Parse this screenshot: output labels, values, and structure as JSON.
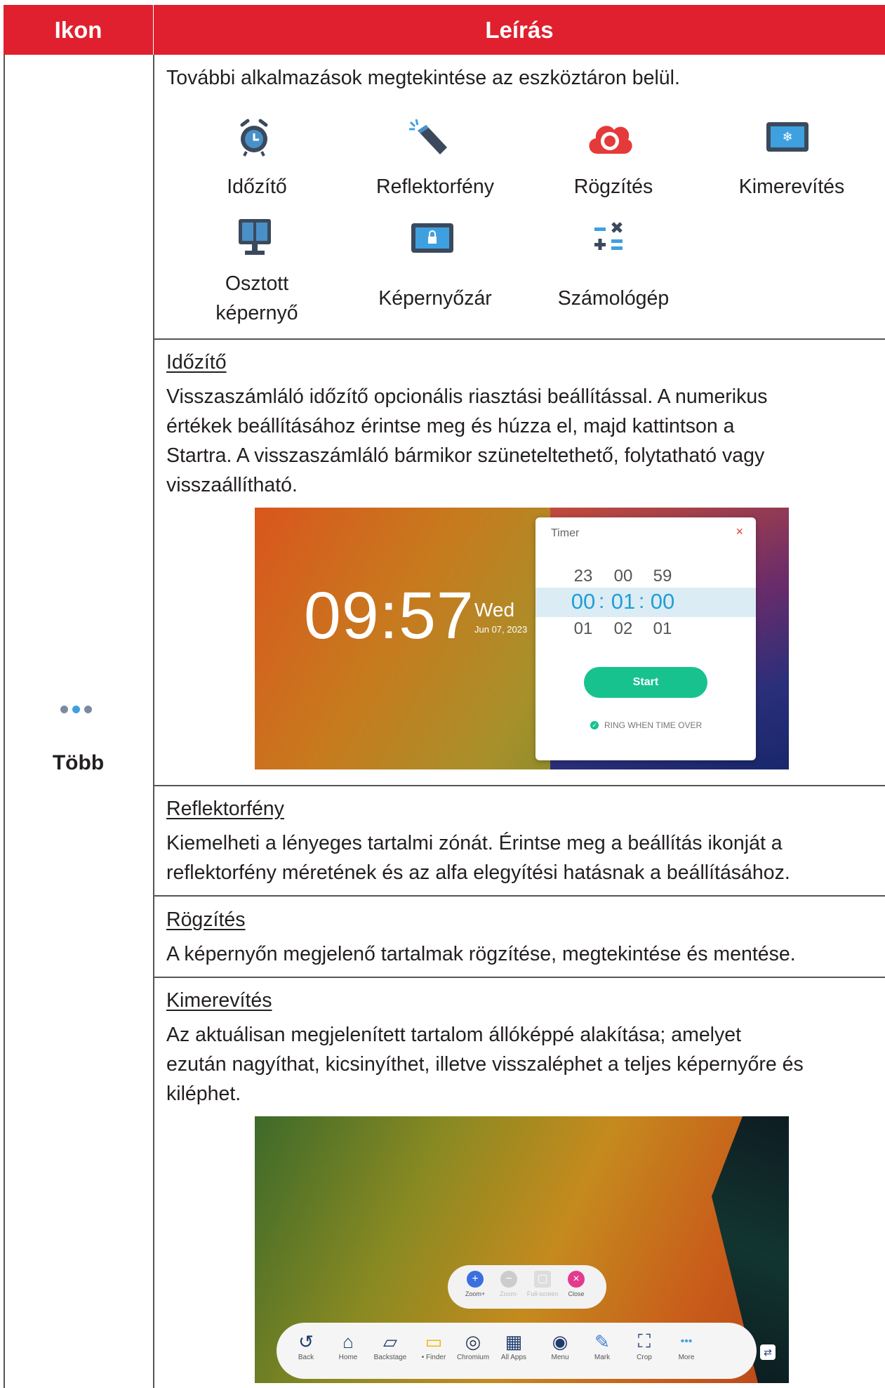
{
  "header": {
    "col1": "Ikon",
    "col2": "Leírás"
  },
  "icon_cell": {
    "label": "Több"
  },
  "intro": "További alkalmazások megtekintése az eszköztáron belül.",
  "apps": [
    {
      "icon": "alarm-clock-icon",
      "label": "Időzítő"
    },
    {
      "icon": "flashlight-icon",
      "label": "Reflektorfény"
    },
    {
      "icon": "record-cloud-icon",
      "label": "Rögzítés"
    },
    {
      "icon": "freeze-snowflake-icon",
      "label": "Kimerevítés"
    },
    {
      "icon": "split-screen-icon",
      "label_line1": "Osztott",
      "label_line2": "képernyő"
    },
    {
      "icon": "screen-lock-icon",
      "label": "Képernyőzár"
    },
    {
      "icon": "calculator-icon",
      "label": "Számológép"
    }
  ],
  "sections": {
    "timer": {
      "title": "Időzítő",
      "lines": [
        "Visszaszámláló időzítő opcionális riasztási beállítással. A numerikus",
        "értékek beállításához érintse meg és húzza el, majd kattintson a",
        "Startra. A visszaszámláló bármikor szüneteltethető, folytatható vagy",
        "visszaállítható."
      ]
    },
    "spotlight": {
      "title": "Reflektorfény",
      "lines": [
        "Kiemelheti a lényeges tartalmi zónát. Érintse meg a beállítás ikonját a",
        "reflektorfény méretének és az alfa elegyítési hatásnak a beállításához."
      ]
    },
    "record": {
      "title": "Rögzítés",
      "lines": [
        "A képernyőn megjelenő tartalmak rögzítése, megtekintése és mentése."
      ]
    },
    "freeze": {
      "title": "Kimerevítés",
      "lines": [
        "Az aktuálisan megjelenített tartalom állóképpé alakítása; amelyet",
        "ezután nagyíthat, kicsinyíthet, illetve visszaléphet a teljes képernyőre és",
        "kiléphet."
      ]
    }
  },
  "timer_screenshot": {
    "clock": "09:57",
    "day": "Wed",
    "date": "Jun 07, 2023",
    "dialog_title": "Timer",
    "close": "×",
    "prev_row": [
      "23",
      "00",
      "59"
    ],
    "selected_row": [
      "00",
      "01",
      "00"
    ],
    "next_row": [
      "01",
      "02",
      "01"
    ],
    "colon": ":",
    "start": "Start",
    "ring": "RING WHEN TIME OVER"
  },
  "freeze_screenshot": {
    "zoom_items": [
      {
        "label": "Zoom+",
        "color": "#3b6fe0",
        "glyph": "+"
      },
      {
        "label": "Zoom-",
        "color": "#cccccc",
        "glyph": "−"
      },
      {
        "label": "Full-screen",
        "color": "#dddddd",
        "glyph": "▢"
      },
      {
        "label": "Close",
        "color": "#e23b8e",
        "glyph": "×"
      }
    ],
    "dock_items": [
      {
        "label": "Back",
        "glyph": "↺"
      },
      {
        "label": "Home",
        "glyph": "⌂"
      },
      {
        "label": "Backstage",
        "glyph": "▱"
      },
      {
        "label": "• Finder",
        "glyph": "▭"
      },
      {
        "label": "Chromium",
        "glyph": "◎"
      },
      {
        "label": "All Apps",
        "glyph": "▦"
      },
      {
        "label": "Menu",
        "glyph": "◉"
      },
      {
        "label": "Mark",
        "glyph": "✎"
      },
      {
        "label": "Crop",
        "glyph": "⛶"
      },
      {
        "label": "More",
        "glyph": "•••"
      }
    ]
  },
  "colors": {
    "header_bg": "#e0202e",
    "accent_blue": "#1f9fd6",
    "start_green": "#17c28f"
  }
}
